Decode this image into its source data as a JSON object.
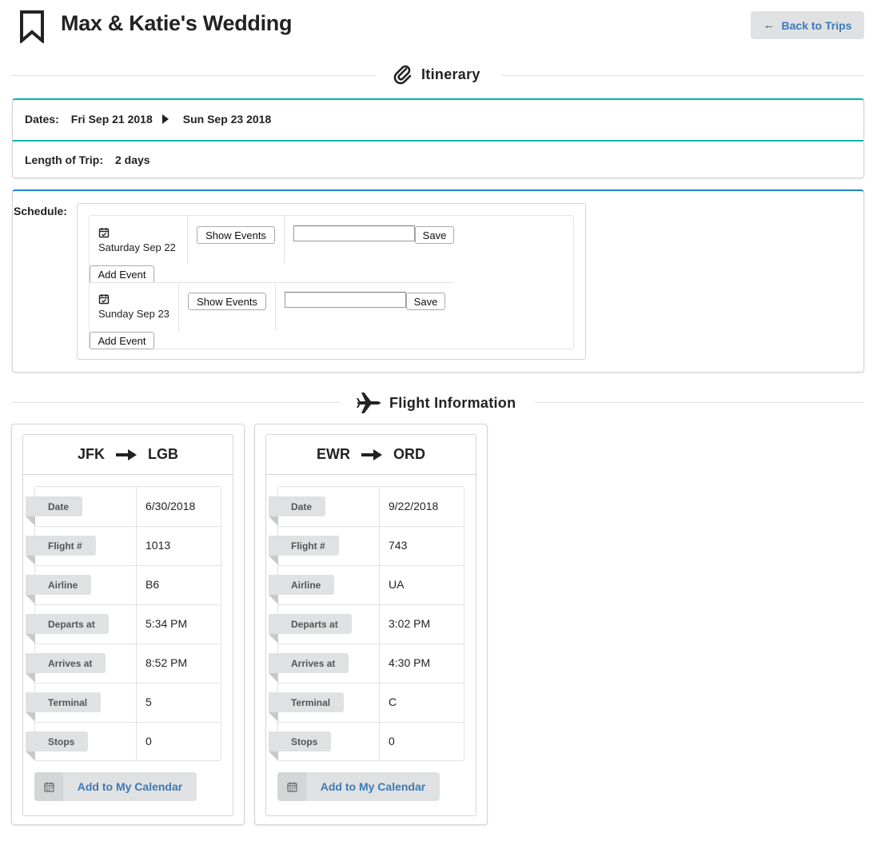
{
  "header": {
    "title": "Max & Katie's Wedding",
    "back_label": "Back to Trips"
  },
  "itinerary": {
    "section_title": "Itinerary",
    "dates_label": "Dates:",
    "start_date": "Fri Sep 21 2018",
    "end_date": "Sun Sep 23 2018",
    "length_label": "Length of Trip:",
    "length_value": "2 days"
  },
  "schedule": {
    "label": "Schedule:",
    "days": [
      {
        "day": "Saturday Sep 22",
        "show_events_label": "Show Events",
        "input_value": "",
        "save_label": "Save",
        "add_event_label": "Add Event"
      },
      {
        "day": "Sunday Sep 23",
        "show_events_label": "Show Events",
        "input_value": "",
        "save_label": "Save",
        "add_event_label": "Add Event"
      }
    ]
  },
  "flights": {
    "section_title": "Flight Information",
    "cards": [
      {
        "from": "JFK",
        "to": "LGB",
        "rows": [
          {
            "label": "Date",
            "value": "6/30/2018"
          },
          {
            "label": "Flight #",
            "value": "1013"
          },
          {
            "label": "Airline",
            "value": "B6"
          },
          {
            "label": "Departs at",
            "value": "5:34 PM"
          },
          {
            "label": "Arrives at",
            "value": "8:52 PM"
          },
          {
            "label": "Terminal",
            "value": "5"
          },
          {
            "label": "Stops",
            "value": "0"
          }
        ],
        "calendar_label": "Add to My Calendar"
      },
      {
        "from": "EWR",
        "to": "ORD",
        "rows": [
          {
            "label": "Date",
            "value": "9/22/2018"
          },
          {
            "label": "Flight #",
            "value": "743"
          },
          {
            "label": "Airline",
            "value": "UA"
          },
          {
            "label": "Departs at",
            "value": "3:02 PM"
          },
          {
            "label": "Arrives at",
            "value": "4:30 PM"
          },
          {
            "label": "Terminal",
            "value": "C"
          },
          {
            "label": "Stops",
            "value": "0"
          }
        ],
        "calendar_label": "Add to My Calendar"
      }
    ]
  },
  "colors": {
    "accent_teal": "#00b5ad",
    "accent_blue": "#2185d0",
    "link_blue": "#3b7ab8"
  }
}
